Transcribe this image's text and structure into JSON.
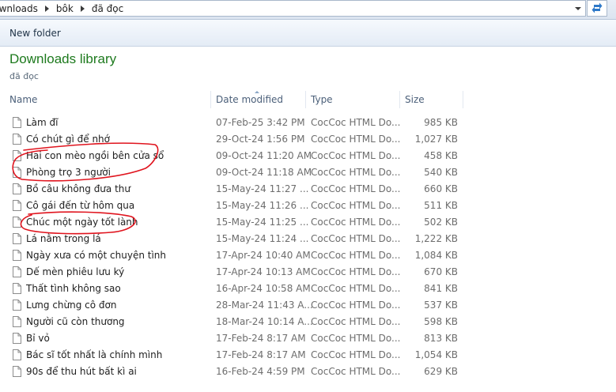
{
  "address_bar": {
    "crumbs": [
      "Downloads",
      "bôk",
      "đã đọc"
    ]
  },
  "toolbar": {
    "new_folder_label": "New folder"
  },
  "library": {
    "title": "Downloads library",
    "subtitle": "đã đọc"
  },
  "columns": {
    "name": "Name",
    "date": "Date modified",
    "type": "Type",
    "size": "Size"
  },
  "files": [
    {
      "name": "Làm đĩ",
      "date": "07-Feb-25 3:42 PM",
      "type": "CocCoc HTML Do...",
      "size": "985 KB"
    },
    {
      "name": "Có chút gì để nhớ",
      "date": "29-Oct-24 1:56 PM",
      "type": "CocCoc HTML Do...",
      "size": "1,027 KB"
    },
    {
      "name": "Hai con mèo ngồi bên cửa sổ",
      "date": "09-Oct-24 11:20 AM",
      "type": "CocCoc HTML Do...",
      "size": "458 KB"
    },
    {
      "name": "Phòng trọ 3 người",
      "date": "09-Oct-24 11:18 AM",
      "type": "CocCoc HTML Do...",
      "size": "540 KB"
    },
    {
      "name": "Bồ câu không đưa thư",
      "date": "15-May-24 11:27 ...",
      "type": "CocCoc HTML Do...",
      "size": "660 KB"
    },
    {
      "name": "Cô gái đến từ hôm qua",
      "date": "15-May-24 11:26 ...",
      "type": "CocCoc HTML Do...",
      "size": "511 KB"
    },
    {
      "name": "Chúc một ngày tốt lành",
      "date": "15-May-24 11:25 ...",
      "type": "CocCoc HTML Do...",
      "size": "502 KB"
    },
    {
      "name": "Lá nằm trong lá",
      "date": "15-May-24 11:24 ...",
      "type": "CocCoc HTML Do...",
      "size": "1,222 KB"
    },
    {
      "name": "Ngày xưa có một chuyện tình",
      "date": "17-Apr-24 10:40 AM",
      "type": "CocCoc HTML Do...",
      "size": "1,084 KB"
    },
    {
      "name": "Dế mèn phiêu lưu ký",
      "date": "17-Apr-24 10:13 AM",
      "type": "CocCoc HTML Do...",
      "size": "670 KB"
    },
    {
      "name": "Thất tình không sao",
      "date": "16-Apr-24 10:58 AM",
      "type": "CocCoc HTML Do...",
      "size": "841 KB"
    },
    {
      "name": "Lưng chừng cô đơn",
      "date": "28-Mar-24 11:43 A...",
      "type": "CocCoc HTML Do...",
      "size": "537 KB"
    },
    {
      "name": "Người cũ còn thương",
      "date": "18-Mar-24 10:14 A...",
      "type": "CocCoc HTML Do...",
      "size": "598 KB"
    },
    {
      "name": "Bỉ vỏ",
      "date": "17-Feb-24 8:17 AM",
      "type": "CocCoc HTML Do...",
      "size": "813 KB"
    },
    {
      "name": "Bác sĩ tốt nhất là chính mình",
      "date": "17-Feb-24 8:17 AM",
      "type": "CocCoc HTML Do...",
      "size": "1,054 KB"
    },
    {
      "name": "90s để thu hút bất kì ai",
      "date": "16-Feb-24 4:59 PM",
      "type": "CocCoc HTML Do...",
      "size": "629 KB"
    }
  ],
  "colors": {
    "library_title": "#1e7a1e",
    "annotation": "#e0141e",
    "header_text": "#4c607a"
  },
  "icons": [
    "chevron-right-icon",
    "chevron-down-icon",
    "refresh-icon",
    "document-icon"
  ]
}
